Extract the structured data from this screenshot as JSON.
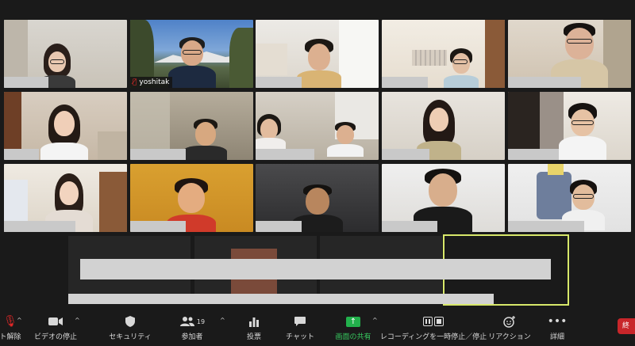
{
  "tiles": [
    {
      "name": "",
      "redacted": true
    },
    {
      "name": "yoshitak",
      "redacted": false,
      "mic_muted": true
    },
    {
      "name": "",
      "redacted": true
    },
    {
      "name": "",
      "redacted": true
    },
    {
      "name": "",
      "redacted": true
    },
    {
      "name": "",
      "redacted": true
    },
    {
      "name": "",
      "redacted": true
    },
    {
      "name": "",
      "redacted": true
    },
    {
      "name": "",
      "redacted": true
    },
    {
      "name": "",
      "redacted": true
    },
    {
      "name": "",
      "redacted": true
    },
    {
      "name": "",
      "redacted": true
    },
    {
      "name": "",
      "redacted": true
    },
    {
      "name": "",
      "redacted": true
    },
    {
      "name": "",
      "redacted": true
    }
  ],
  "toolbar": {
    "mute_label": "ト解除",
    "video_label": "ビデオの停止",
    "security_label": "セキュリティ",
    "participants_label": "参加者",
    "participants_count": "19",
    "poll_label": "投票",
    "chat_label": "チャット",
    "share_label": "画面の共有",
    "record_label": "レコーディングを一時停止／停止",
    "reaction_label": "リアクション",
    "more_label": "詳細",
    "end_label": "終"
  },
  "colors": {
    "active_speaker_border": "#d8e86a",
    "share_green": "#22b14c",
    "end_red": "#c8262a",
    "mic_off_red": "#e02828"
  }
}
